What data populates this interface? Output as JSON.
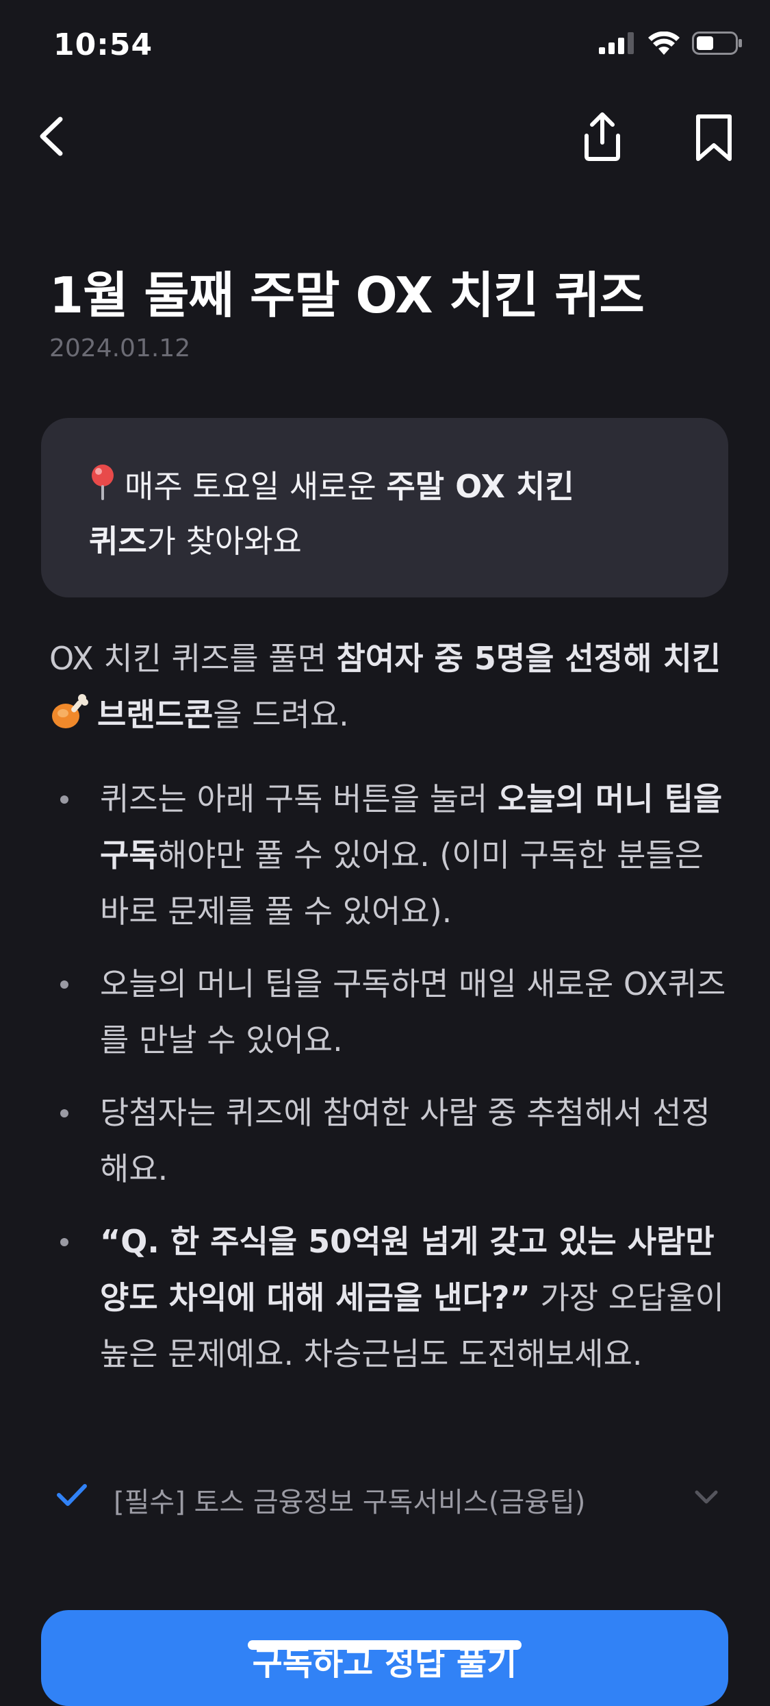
{
  "status_bar": {
    "time": "10:54"
  },
  "article": {
    "title": "1월 둘째 주말 OX 치킨 퀴즈",
    "date": "2024.01.12"
  },
  "notice": {
    "icon": "pin-icon",
    "text_pre": "매주 토요일 새로운 ",
    "text_bold": "주말 OX 치킨 퀴즈",
    "text_post": "가 찾아와요"
  },
  "intro": {
    "text_pre": "OX 치킨 퀴즈를 풀면 ",
    "text_bold": "참여자 중 5명을 선정해 치킨 ",
    "icon": "chicken-leg-icon",
    "text_bold2": "브랜드콘",
    "text_post": "을 드려요."
  },
  "bullets": [
    {
      "pre": "퀴즈는 아래 구독 버튼을 눌러 ",
      "bold": "오늘의 머니 팁을 구독",
      "post": "해야만 풀 수 있어요. (이미 구독한 분들은 바로 문제를 풀 수 있어요)."
    },
    {
      "pre": "오늘의 머니 팁을 구독하면 매일 새로운 OX퀴즈를 만날 수 있어요.",
      "bold": "",
      "post": ""
    },
    {
      "pre": "당첨자는 퀴즈에 참여한 사람 중 추첨해서 선정해요.",
      "bold": "",
      "post": ""
    },
    {
      "pre": "",
      "bold": "“Q. 한 주식을 50억원 넘게 갖고 있는 사람만 양도 차익에 대해 세금을 낸다?”",
      "post": " 가장 오답율이 높은 문제예요. 차승근님도 도전해보세요."
    }
  ],
  "consent": {
    "label": "[필수] 토스 금융정보 구독서비스(금융팁)",
    "checked": true
  },
  "cta": {
    "label": "구독하고 정답 풀기"
  },
  "colors": {
    "background": "#17171c",
    "card": "#2c2c35",
    "accent": "#3182f6"
  }
}
